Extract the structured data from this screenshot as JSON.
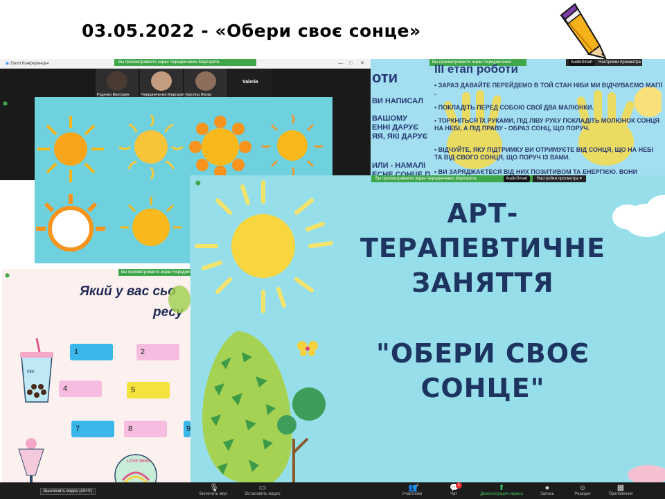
{
  "page_title": "03.05.2022 - «Обери своє сонце»",
  "colors": {
    "slide_blue": "#96dfea",
    "text_navy": "#1d3461",
    "zoom_green": "#3fa64a",
    "sun_yellow": "#f9d23c",
    "toolbar": "#1c1c1c"
  },
  "zoom_window": {
    "title": "Zoom Конференция",
    "share_notice": "Вы просматриваете экран Чередниченко Маргарита",
    "share_notice_short": "Вы просматриваете экран Чередниченко",
    "audiosmart": "AudioSmart",
    "view_settings": "Настройки просмотра",
    "participants": [
      "Руденко Виктория",
      "Чередниченко Маргарита",
      "Крістіна Яхова",
      "Valeria"
    ]
  },
  "steps_slide": {
    "heading": "III етап роботи",
    "left_heading_fragment": "оти",
    "left_fragments": [
      "ВИ НАПИСАЛ",
      "ВАШОМУ",
      "ЕННІ ДАРУЄ",
      "ЯЯ, ЯКІ ДАРУЄ",
      "ИЛИ - НАМАЛІ",
      "ЕСНЕ СОНЦЕ П"
    ],
    "bullets": [
      "ЗАРАЗ ДАВАЙТЕ ПЕРЕЙДЕМО В ТОЙ СТАН НІБИ МИ ВІДЧУВАЄМО МАГІЇ .",
      "ПОКЛАДІТЬ ПЕРЕД СОБОЮ СВОЇ ДВА МАЛЮНКИ.",
      "ТОРКНІТЬСЯ ЇХ РУКАМИ, ПІД ЛІВУ РУКУ ПОКЛАДІТЬ МОЛЮНОК СОНЦЯ НА НЕБІ, А ПІД ПРАВУ - ОБРАЗ СОНЦ, ЩО ПОРУЧ.",
      "ВІДЧУЙТЕ, ЯКУ ПІДТРИМКУ ВИ ОТРИМУЄТЕ ВІД СОНЦЯ, ЩО НА НЕБІ ТА ВІД СВОГО СОНЦЯ, ЩО ПОРУЧ ІЗ ВАМИ.",
      "ВИ ЗАРЯДЖАЄТЕСЯ ВІД НИХ ПОЗИТИВОМ ТА ЕНЕРГІЄЮ. ВОНИ"
    ]
  },
  "main_slide": {
    "line1": "АРТ-",
    "line2": "ТЕРАПЕВТИЧНЕ",
    "line3": "ЗАНЯТТЯ",
    "line4": "\"ОБЕРИ СВОЄ",
    "line5": "СОНЦЕ\""
  },
  "resource_slide": {
    "question_line1": "Який у вас сьо",
    "question_line2": "ресу",
    "badge_text": "LOVE WINS",
    "milk_text": "Milk",
    "pills": [
      {
        "label": "1",
        "color": "#3bb6e8"
      },
      {
        "label": "2",
        "color": "#f7bde0"
      },
      {
        "label": "4",
        "color": "#f7bde0"
      },
      {
        "label": "5",
        "color": "#f5e23c"
      },
      {
        "label": "7",
        "color": "#3bb6e8"
      },
      {
        "label": "8",
        "color": "#f7bde0"
      },
      {
        "label": "9",
        "color": "#3bb6e8"
      }
    ]
  },
  "toolbar": {
    "tooltip": "Выключить видео (Alt+V)",
    "buttons": [
      {
        "label": "Включить звук",
        "icon": "🎙"
      },
      {
        "label": "Остановить видео",
        "icon": "▭"
      },
      {
        "label": "Участники",
        "icon": "👥",
        "count": "4"
      },
      {
        "label": "Чат",
        "icon": "💬",
        "count": "1"
      },
      {
        "label": "Демонстрация экрана",
        "icon": "⬆"
      },
      {
        "label": "Запись",
        "icon": "●"
      },
      {
        "label": "Реакции",
        "icon": "☺"
      },
      {
        "label": "Приложения",
        "icon": "▦"
      }
    ]
  }
}
